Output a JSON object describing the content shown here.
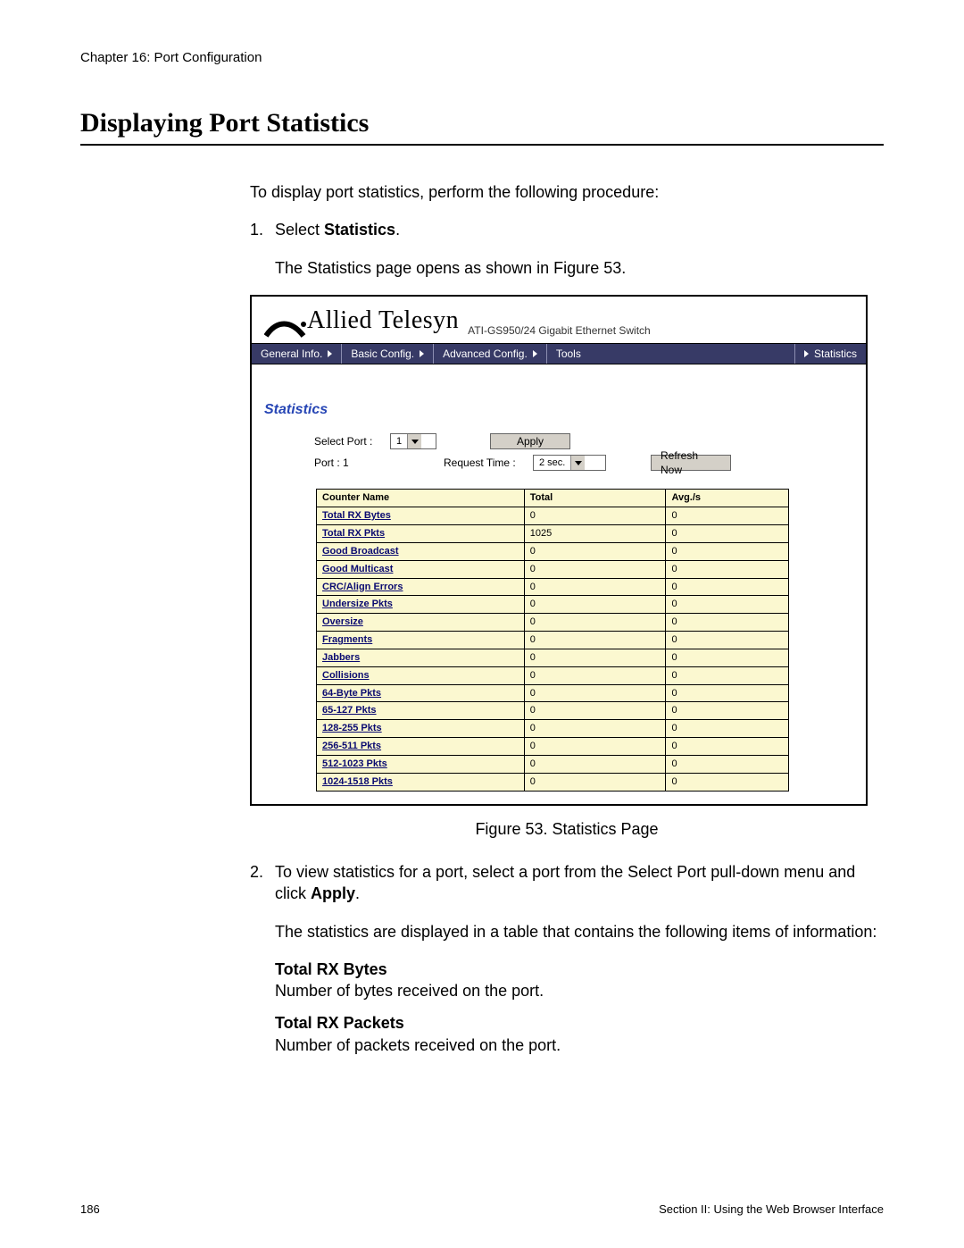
{
  "chapter": "Chapter 16: Port Configuration",
  "title": "Displaying Port Statistics",
  "intro": "To display port statistics, perform the following procedure:",
  "steps": {
    "s1_num": "1.",
    "s1_pre": "Select ",
    "s1_bold": "Statistics",
    "s1_post": ".",
    "s1_follow": "The Statistics page opens as shown in Figure 53.",
    "s2_num": "2.",
    "s2_pre": "To view statistics for a port, select a port from the Select Port pull-down menu and click ",
    "s2_bold": "Apply",
    "s2_post": ".",
    "s2_follow": "The statistics are displayed in a table that contains the following items of information:"
  },
  "fig": {
    "brand": "Allied Telesyn",
    "product": "ATI-GS950/24 Gigabit Ethernet Switch",
    "menu": {
      "m1": "General Info.",
      "m2": "Basic Config.",
      "m3": "Advanced Config.",
      "m4": "Tools",
      "m5": "Statistics"
    },
    "panel_title": "Statistics",
    "controls": {
      "select_port_label": "Select Port :",
      "select_port_value": "1",
      "port_label": "Port : 1",
      "apply_btn": "Apply",
      "request_time_label": "Request Time :",
      "request_time_value": "2 sec.",
      "refresh_btn": "Refresh Now"
    },
    "table": {
      "h1": "Counter Name",
      "h2": "Total",
      "h3": "Avg./s",
      "rows": [
        {
          "n": "Total RX Bytes",
          "t": "0",
          "a": "0"
        },
        {
          "n": "Total RX Pkts",
          "t": "1025",
          "a": "0"
        },
        {
          "n": "Good Broadcast",
          "t": "0",
          "a": "0"
        },
        {
          "n": "Good Multicast",
          "t": "0",
          "a": "0"
        },
        {
          "n": "CRC/Align Errors",
          "t": "0",
          "a": "0"
        },
        {
          "n": "Undersize Pkts",
          "t": "0",
          "a": "0"
        },
        {
          "n": "Oversize",
          "t": "0",
          "a": "0"
        },
        {
          "n": "Fragments",
          "t": "0",
          "a": "0"
        },
        {
          "n": "Jabbers",
          "t": "0",
          "a": "0"
        },
        {
          "n": "Collisions",
          "t": "0",
          "a": "0"
        },
        {
          "n": "64-Byte Pkts",
          "t": "0",
          "a": "0"
        },
        {
          "n": "65-127 Pkts",
          "t": "0",
          "a": "0"
        },
        {
          "n": "128-255 Pkts",
          "t": "0",
          "a": "0"
        },
        {
          "n": "256-511 Pkts",
          "t": "0",
          "a": "0"
        },
        {
          "n": "512-1023 Pkts",
          "t": "0",
          "a": "0"
        },
        {
          "n": "1024-1518 Pkts",
          "t": "0",
          "a": "0"
        }
      ]
    },
    "caption": "Figure 53. Statistics Page"
  },
  "defs": {
    "d1t": "Total RX Bytes",
    "d1d": "Number of bytes received on the port.",
    "d2t": "Total RX Packets",
    "d2d": "Number of packets received on the port."
  },
  "footer": {
    "page": "186",
    "section": "Section II: Using the Web Browser Interface"
  }
}
